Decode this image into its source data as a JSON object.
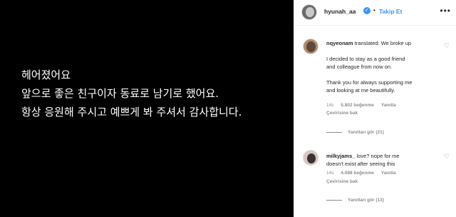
{
  "post": {
    "lines": [
      "헤어졌어요",
      "앞으로 좋은 친구이자 동료로 남기로 했어요.",
      "항상 응원해 주시고 예쁘게 봐 주셔서 감사합니다."
    ]
  },
  "header": {
    "username": "hyunah_aa",
    "verified_icon": "verified-badge-icon",
    "separator": "•",
    "follow_label": "Takip Et",
    "more_icon": "more-options-icon"
  },
  "comments": [
    {
      "username": "nqyeonam",
      "lines": [
        "translated: We broke up",
        "",
        "I decided to stay as a good friend",
        "and colleague from now on.",
        "",
        "Thank you for always supporting me",
        "and looking at me beautifully."
      ],
      "time": "14s",
      "likes": "5.802 beğenme",
      "reply_label": "Yanıtla",
      "translate_label": "Çevirisine bak",
      "view_replies": "Yanıtları gör (21)"
    },
    {
      "username": "milkyjams_",
      "lines": [
        "love? nope for me",
        "doesn't exist after seeing this"
      ],
      "time": "14s",
      "likes": "4.088 beğenme",
      "reply_label": "Yanıtla",
      "translate_label": "Çevirisine bak",
      "view_replies": "Yanıtları gör (13)"
    }
  ],
  "colors": {
    "accent": "#3897f0",
    "secondary_text": "#8e8e8e",
    "post_background": "#000000"
  }
}
